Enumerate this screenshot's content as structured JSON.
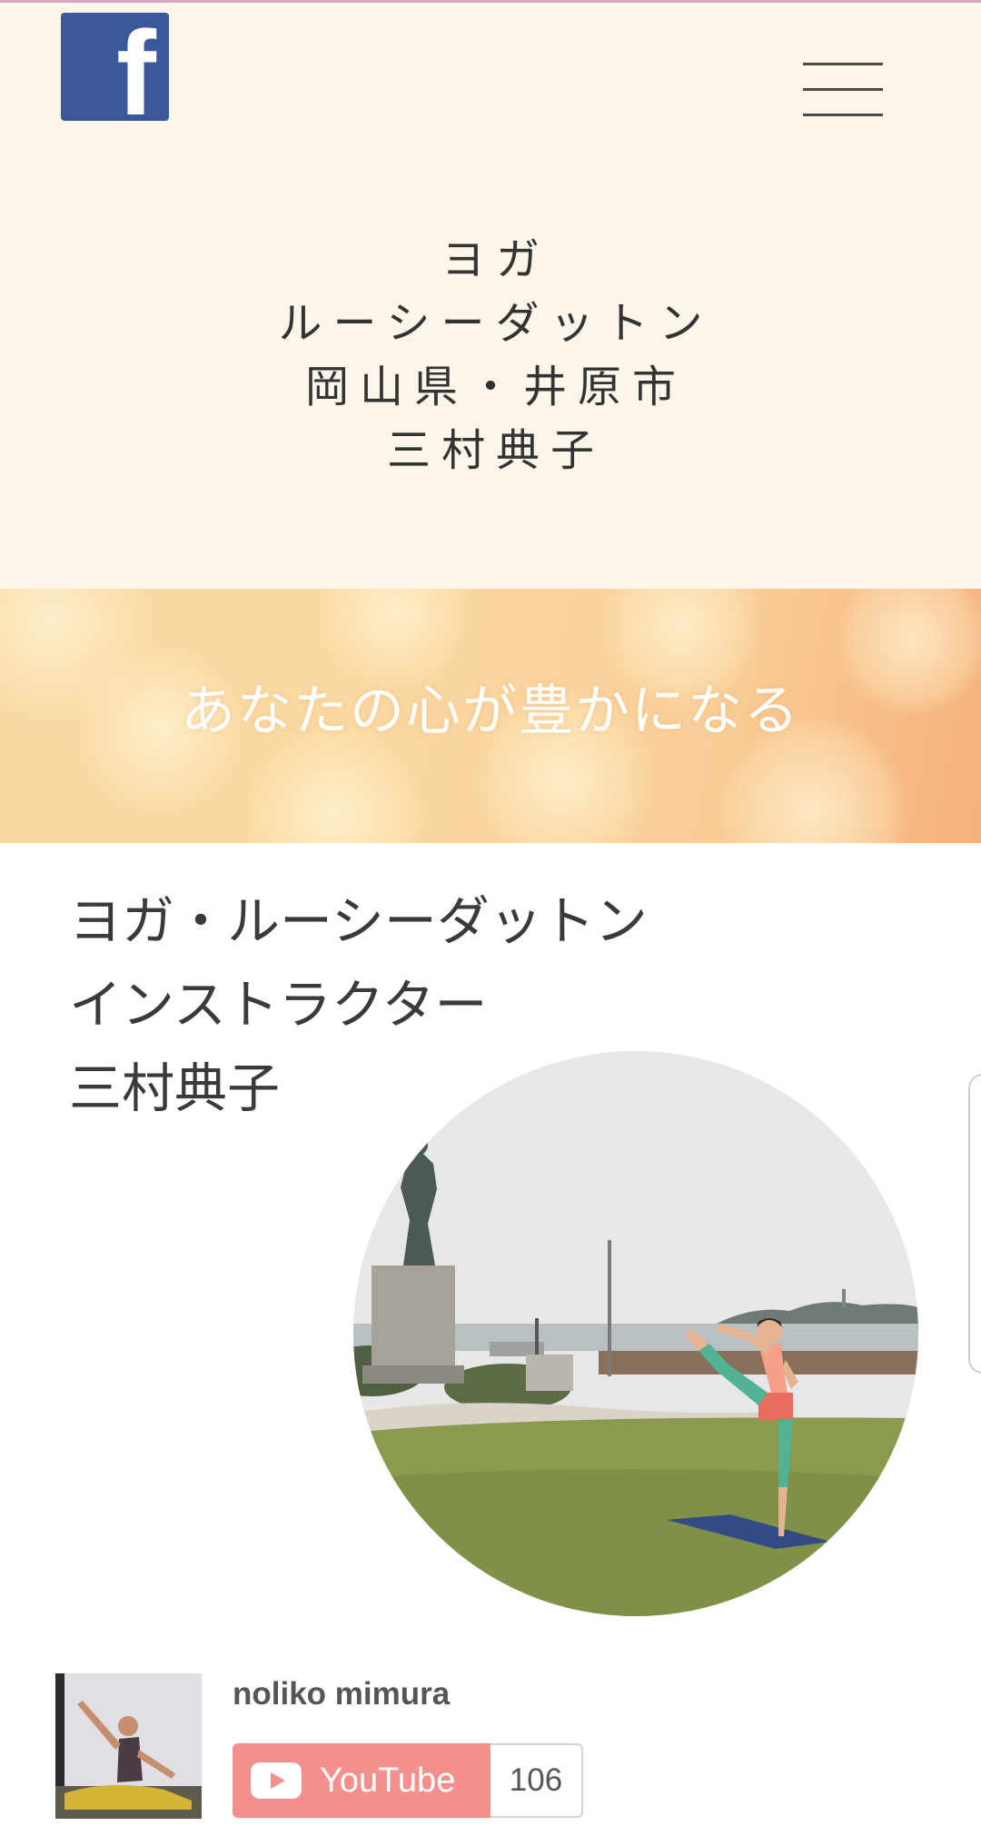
{
  "header": {
    "facebook_icon": "facebook-icon",
    "menu_icon": "hamburger-menu-icon",
    "title_lines": [
      "ヨガ",
      "ルーシーダットン",
      "岡山県・井原市",
      "三村典子"
    ]
  },
  "banner": {
    "tagline": "あなたの心が豊かになる"
  },
  "content": {
    "title_lines": [
      "ヨガ・ルーシーダットン",
      "インストラクター",
      "三村典子"
    ]
  },
  "youtube": {
    "channel_name": "noliko mimura",
    "button_label": "YouTube",
    "subscriber_count": "106"
  },
  "colors": {
    "header_bg": "#fbf5ea",
    "banner_accent": "#f9cf99",
    "youtube_button": "#f3908d",
    "facebook_blue": "#3b5998"
  }
}
